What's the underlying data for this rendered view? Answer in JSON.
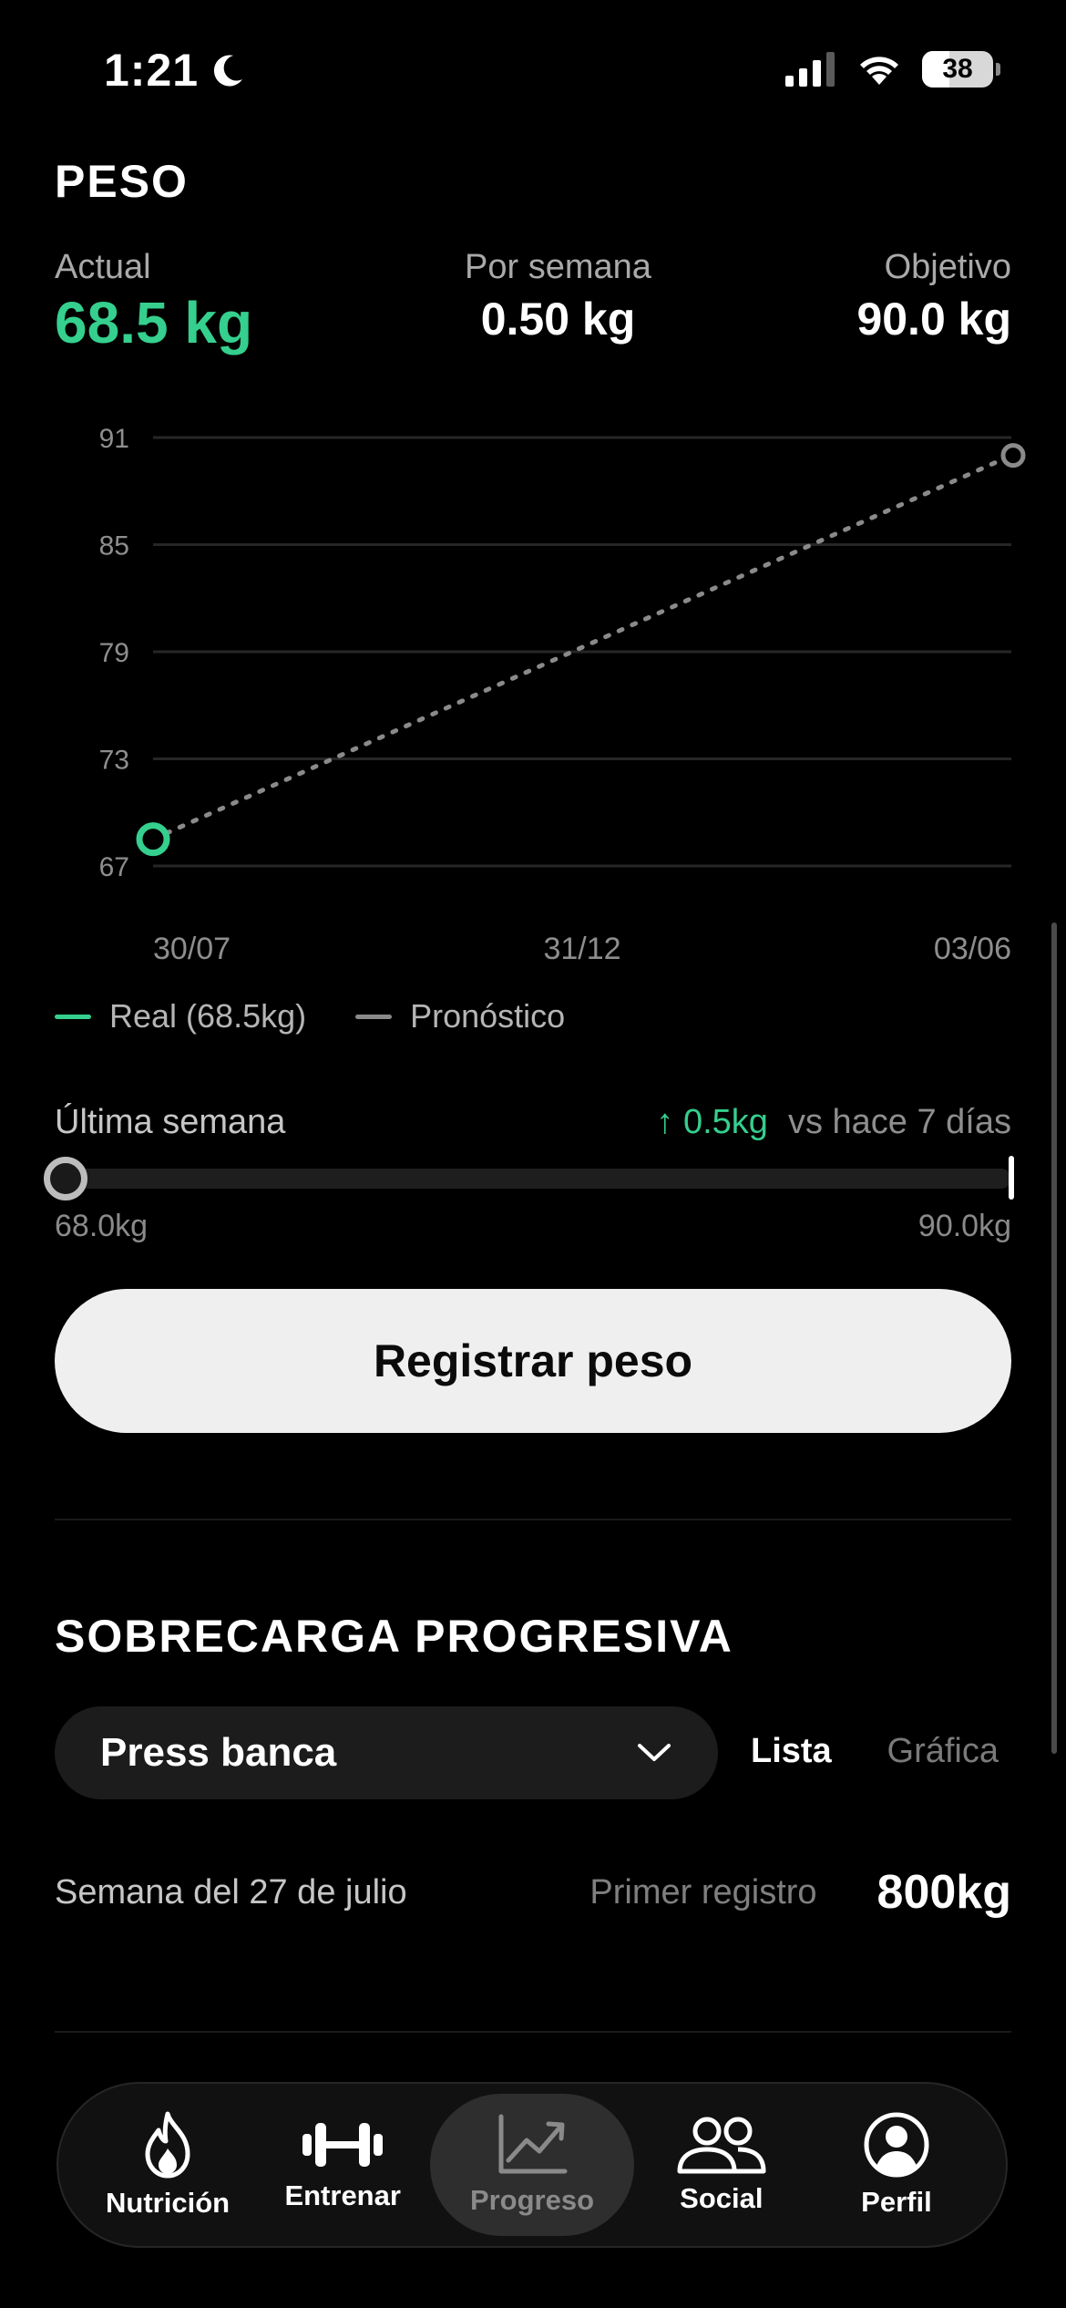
{
  "status_bar": {
    "time": "1:21",
    "battery": "38",
    "battery_level": 0.38
  },
  "weight": {
    "title": "PESO",
    "actual_label": "Actual",
    "actual_value": "68.5 kg",
    "per_week_label": "Por semana",
    "per_week_value": "0.50 kg",
    "goal_label": "Objetivo",
    "goal_value": "90.0 kg"
  },
  "chart_data": {
    "type": "line",
    "ylim": [
      67,
      91
    ],
    "yticks": [
      "91",
      "85",
      "79",
      "73",
      "67"
    ],
    "x_ticks": [
      "30/07",
      "31/12",
      "03/06"
    ],
    "series": [
      {
        "name": "Real (68.5kg)",
        "color": "#35cf8e",
        "points": [
          [
            "30/07",
            68.5
          ]
        ]
      },
      {
        "name": "Pronóstico",
        "color": "#8a8a8a",
        "style": "dotted",
        "points": [
          [
            "30/07",
            68.5
          ],
          [
            "03/06",
            90.0
          ]
        ]
      }
    ],
    "grid": true,
    "legend_position": "bottom-left"
  },
  "legend": {
    "real": "Real (68.5kg)",
    "forecast": "Pronóstico"
  },
  "last_week": {
    "label": "Última semana",
    "change": "↑ 0.5kg",
    "comparison": "vs hace 7 días",
    "min_label": "68.0kg",
    "max_label": "90.0kg"
  },
  "register_button": "Registrar peso",
  "overload": {
    "title": "SOBRECARGA PROGRESIVA",
    "exercise": "Press banca",
    "view_list": "Lista",
    "view_chart": "Gráfica",
    "week_label": "Semana del 27 de julio",
    "week_sub": "Primer registro",
    "week_value": "800kg"
  },
  "tabs": [
    {
      "label": "Nutrición",
      "icon": "flame-icon"
    },
    {
      "label": "Entrenar",
      "icon": "dumbbell-icon"
    },
    {
      "label": "Progreso",
      "icon": "chart-trend-icon",
      "active": true
    },
    {
      "label": "Social",
      "icon": "people-icon"
    },
    {
      "label": "Perfil",
      "icon": "profile-icon"
    }
  ],
  "colors": {
    "accent": "#35cf8e",
    "background": "#000000",
    "button_bg": "#efefef"
  }
}
